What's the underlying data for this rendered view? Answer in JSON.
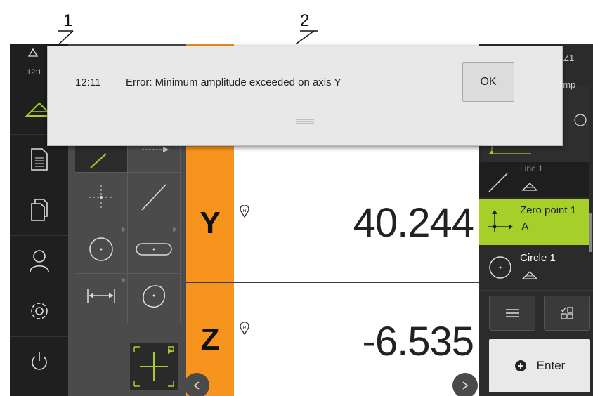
{
  "callouts": {
    "one": "1",
    "two": "2"
  },
  "status_bar": {
    "time": "12:1",
    "right_text": "Z1",
    "temp_text": "emp"
  },
  "axes": [
    {
      "label": "Y",
      "value": "40.244"
    },
    {
      "label": "Z",
      "value": "-6.535"
    }
  ],
  "features": [
    {
      "name": "Line 1"
    },
    {
      "name": "Zero point 1"
    },
    {
      "name": "Circle 1"
    }
  ],
  "buttons": {
    "enter": "Enter",
    "ok": "OK"
  },
  "message": {
    "time": "12:11",
    "text": "Error: Minimum amplitude exceeded on axis Y"
  },
  "colors": {
    "axis_accent": "#f7941e",
    "selected_feature": "#a7cf2a",
    "sidebar": "#1f1f1f"
  },
  "icons": [
    "warning-icon",
    "measure-icon",
    "protocol-icon",
    "files-icon",
    "user-icon",
    "settings-icon",
    "power-icon",
    "point-tool-icon",
    "line-tool-icon",
    "circle-tool-icon",
    "slot-tool-icon",
    "distance-tool-icon",
    "freeform-tool-icon",
    "crosshair-icon",
    "menu-icon",
    "filter-icon",
    "plus-circle-icon",
    "drag-handle-icon",
    "reference-marker-icon"
  ]
}
